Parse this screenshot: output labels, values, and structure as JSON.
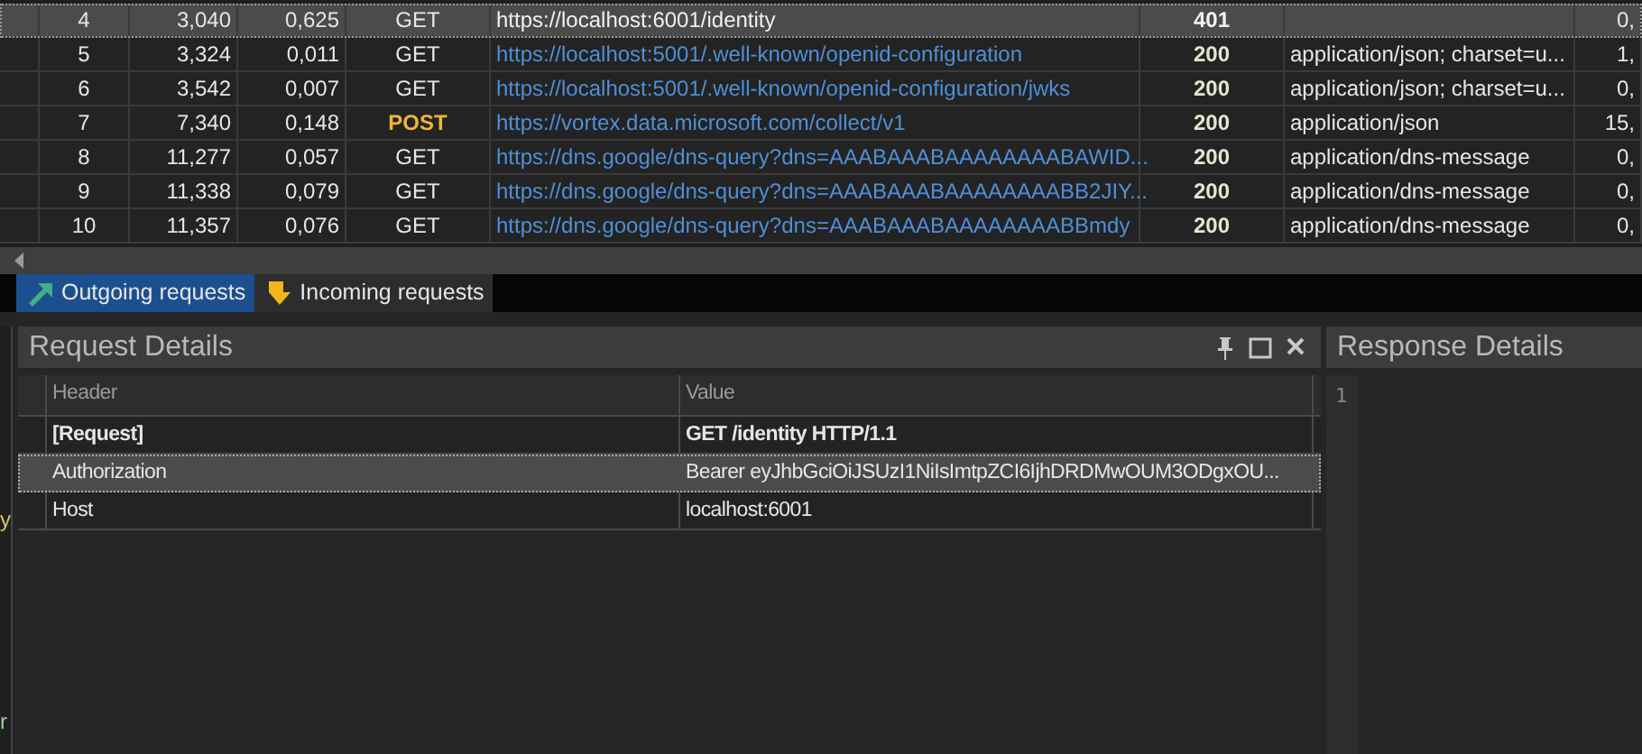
{
  "requests": {
    "rows": [
      {
        "number": "4",
        "time": "3,040",
        "duration": "0,625",
        "method": "GET",
        "method_highlighted": false,
        "url": "https://localhost:6001/identity",
        "status": "401",
        "status_error": true,
        "column_8": "0,",
        "selected": true
      },
      {
        "number": "5",
        "time": "3,324",
        "duration": "0,011",
        "method": "GET",
        "method_highlighted": false,
        "url": "https://localhost:5001/.well-known/openid-configuration",
        "status": "200",
        "status_error": false,
        "content_type": "application/json; charset=u...",
        "column_8": "1,",
        "selected": false
      },
      {
        "number": "6",
        "time": "3,542",
        "duration": "0,007",
        "method": "GET",
        "method_highlighted": false,
        "url": "https://localhost:5001/.well-known/openid-configuration/jwks",
        "status": "200",
        "status_error": false,
        "content_type": "application/json; charset=u...",
        "column_8": "0,",
        "selected": false
      },
      {
        "number": "7",
        "time": "7,340",
        "duration": "0,148",
        "method": "POST",
        "method_highlighted": true,
        "url": "https://vortex.data.microsoft.com/collect/v1",
        "status": "200",
        "status_error": false,
        "content_type": "application/json",
        "column_8": "15,",
        "selected": false
      },
      {
        "number": "8",
        "time": "11,277",
        "duration": "0,057",
        "method": "GET",
        "method_highlighted": false,
        "url": "https://dns.google/dns-query?dns=AAABAAABAAAAAAAABAWID...",
        "status": "200",
        "status_error": false,
        "content_type": "application/dns-message",
        "column_8": "0,",
        "selected": false
      },
      {
        "number": "9",
        "time": "11,338",
        "duration": "0,079",
        "method": "GET",
        "method_highlighted": false,
        "url": "https://dns.google/dns-query?dns=AAABAAABAAAAAAAABB2JIY...",
        "status": "200",
        "status_error": false,
        "content_type": "application/dns-message",
        "column_8": "0,",
        "selected": false
      },
      {
        "number": "10",
        "time": "11,357",
        "duration": "0,076",
        "method": "GET",
        "method_highlighted": false,
        "url": "https://dns.google/dns-query?dns=AAABAAABAAAAAAAABBmdy",
        "status": "200",
        "status_error": false,
        "content_type": "application/dns-message",
        "column_8": "0,",
        "selected": false
      }
    ]
  },
  "tabs": [
    {
      "label": "Outgoing requests",
      "kind": "outgoing",
      "selected": true
    },
    {
      "label": "Incoming requests",
      "kind": "incoming",
      "selected": false
    }
  ],
  "request_details": {
    "title": "Request Details",
    "columns": [
      "Header",
      "Value"
    ],
    "rows": [
      {
        "header": "[Request]",
        "value": "GET /identity HTTP/1.1",
        "kind": "request-line",
        "selected": false
      },
      {
        "header": "Authorization",
        "value": "Bearer eyJhbGciOiJSUzI1NiIsImtpZCI6IjhDRDMwOUM3ODgxOU...",
        "kind": "header",
        "selected": true
      },
      {
        "header": "Host",
        "value": "localhost:6001",
        "kind": "header",
        "selected": false
      }
    ]
  },
  "response_details": {
    "title": "Response Details",
    "line_numbers": [
      "1"
    ]
  },
  "left_edge_texts": [
    "y",
    "r"
  ]
}
